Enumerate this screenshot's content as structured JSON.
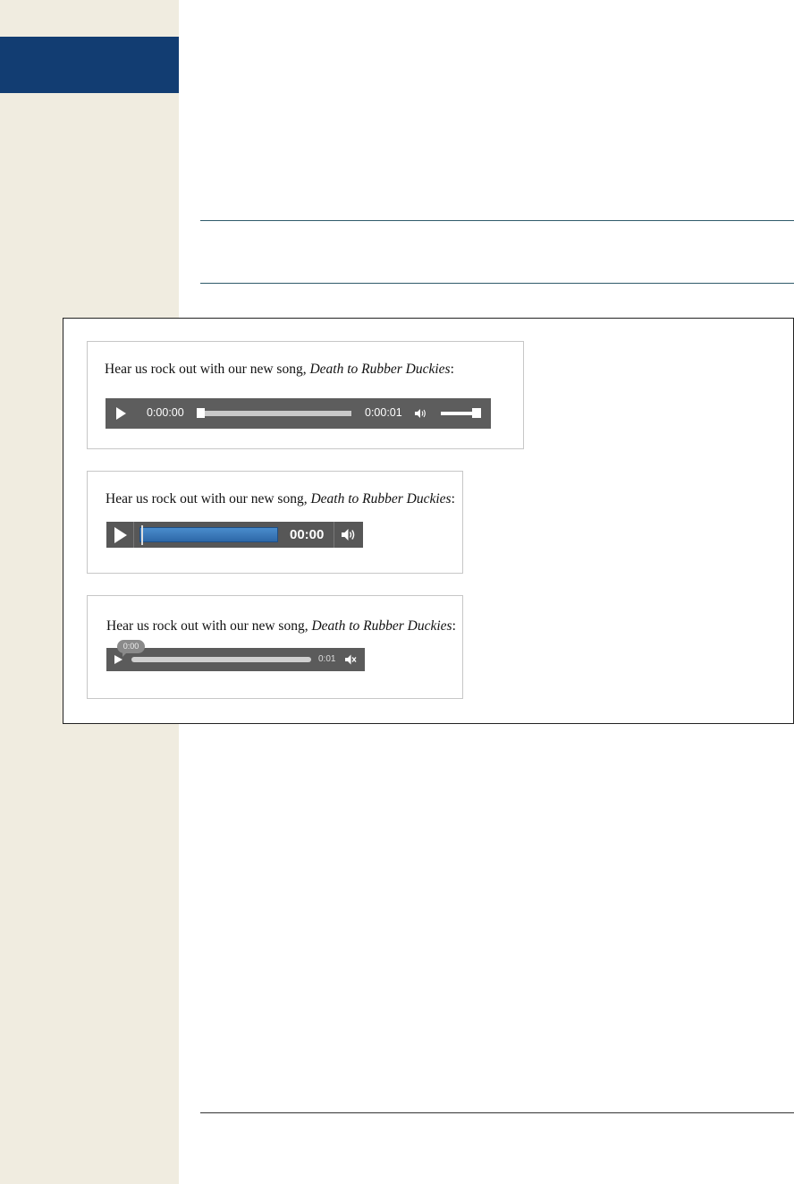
{
  "caption": {
    "prefix": "Hear us rock out with our new song, ",
    "song_title": "Death to Rubber Duckies",
    "suffix": ":"
  },
  "player1": {
    "current_time": "0:00:00",
    "duration": "0:00:01",
    "progress": 0,
    "volume": 1.0
  },
  "player2": {
    "time": "00:00",
    "progress": 0
  },
  "player3": {
    "bubble_time": "0:00",
    "duration": "0:01",
    "progress": 0
  },
  "colors": {
    "sidebar": "#f0ece0",
    "sidebar_tab": "#123d72",
    "player_gray": "#5d5d5d",
    "progress_blue": "#2d68a8"
  },
  "icons": [
    "play-icon",
    "volume-icon"
  ]
}
